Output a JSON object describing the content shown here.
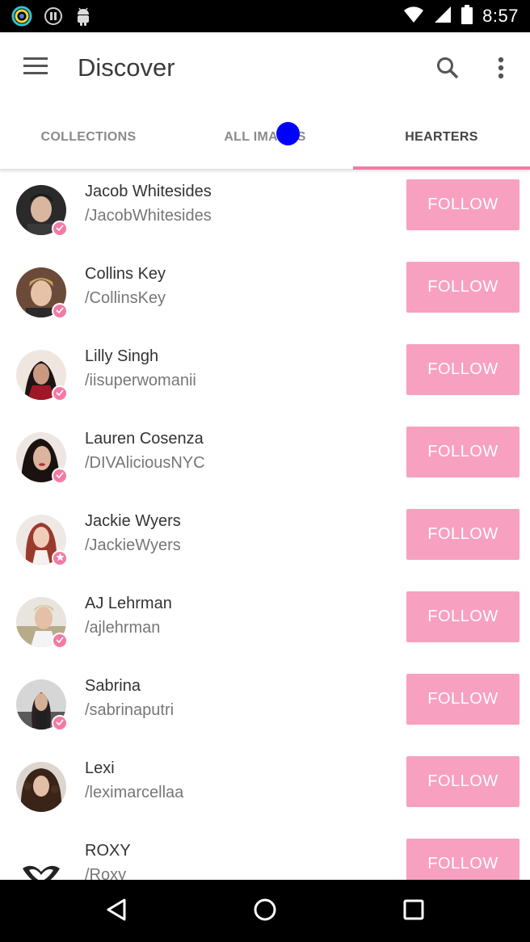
{
  "status_bar": {
    "time": "8:57",
    "icons": [
      "ring-app-icon",
      "pause-icon",
      "android-icon",
      "wifi-icon",
      "signal-icon",
      "battery-icon"
    ]
  },
  "app_bar": {
    "title": "Discover",
    "icons": [
      "menu-icon",
      "search-icon",
      "more-vert-icon"
    ]
  },
  "tabs": [
    {
      "label": "COLLECTIONS",
      "selected": false
    },
    {
      "label": "ALL IMAGES",
      "selected": false
    },
    {
      "label": "HEARTERS",
      "selected": true
    }
  ],
  "colors": {
    "accent": "#f47aa5",
    "follow_button": "#f8a0c0",
    "badge": "#f47aa5",
    "touch_indicator": "#0000ff"
  },
  "hearters": [
    {
      "name": "Jacob Whitesides",
      "handle": "/JacobWhitesides",
      "button": "FOLLOW",
      "badge": "check-icon"
    },
    {
      "name": "Collins Key",
      "handle": "/CollinsKey",
      "button": "FOLLOW",
      "badge": "check-icon"
    },
    {
      "name": "Lilly Singh",
      "handle": "/iisuperwomanii",
      "button": "FOLLOW",
      "badge": "check-icon"
    },
    {
      "name": "Lauren Cosenza",
      "handle": "/DIVAliciousNYC",
      "button": "FOLLOW",
      "badge": "check-icon"
    },
    {
      "name": "Jackie Wyers",
      "handle": "/JackieWyers",
      "button": "FOLLOW",
      "badge": "star-icon"
    },
    {
      "name": "AJ Lehrman",
      "handle": "/ajlehrman",
      "button": "FOLLOW",
      "badge": "check-icon"
    },
    {
      "name": "Sabrina",
      "handle": "/sabrinaputri",
      "button": "FOLLOW",
      "badge": "check-icon"
    },
    {
      "name": "Lexi",
      "handle": "/leximarcellaa",
      "button": "FOLLOW",
      "badge": "none"
    },
    {
      "name": "ROXY",
      "handle": "/Roxy",
      "button": "FOLLOW",
      "badge": "none"
    }
  ],
  "nav_bar": {
    "icons": [
      "back-icon",
      "home-icon",
      "recents-icon"
    ]
  }
}
